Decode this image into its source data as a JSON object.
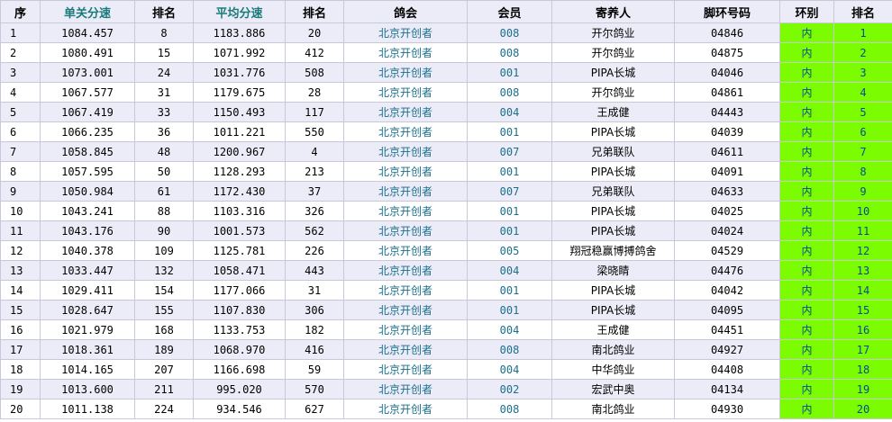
{
  "headers": [
    "序",
    "单关分速",
    "排名",
    "平均分速",
    "排名",
    "鸽会",
    "会员",
    "寄养人",
    "脚环号码",
    "环别",
    "排名"
  ],
  "rows": [
    [
      "1",
      "1084.457",
      "8",
      "1183.886",
      "20",
      "北京开创者",
      "008",
      "开尔鸽业",
      "04846",
      "内",
      "1"
    ],
    [
      "2",
      "1080.491",
      "15",
      "1071.992",
      "412",
      "北京开创者",
      "008",
      "开尔鸽业",
      "04875",
      "内",
      "2"
    ],
    [
      "3",
      "1073.001",
      "24",
      "1031.776",
      "508",
      "北京开创者",
      "001",
      "PIPA长城",
      "04046",
      "内",
      "3"
    ],
    [
      "4",
      "1067.577",
      "31",
      "1179.675",
      "28",
      "北京开创者",
      "008",
      "开尔鸽业",
      "04861",
      "内",
      "4"
    ],
    [
      "5",
      "1067.419",
      "33",
      "1150.493",
      "117",
      "北京开创者",
      "004",
      "王成健",
      "04443",
      "内",
      "5"
    ],
    [
      "6",
      "1066.235",
      "36",
      "1011.221",
      "550",
      "北京开创者",
      "001",
      "PIPA长城",
      "04039",
      "内",
      "6"
    ],
    [
      "7",
      "1058.845",
      "48",
      "1200.967",
      "4",
      "北京开创者",
      "007",
      "兄弟联队",
      "04611",
      "内",
      "7"
    ],
    [
      "8",
      "1057.595",
      "50",
      "1128.293",
      "213",
      "北京开创者",
      "001",
      "PIPA长城",
      "04091",
      "内",
      "8"
    ],
    [
      "9",
      "1050.984",
      "61",
      "1172.430",
      "37",
      "北京开创者",
      "007",
      "兄弟联队",
      "04633",
      "内",
      "9"
    ],
    [
      "10",
      "1043.241",
      "88",
      "1103.316",
      "326",
      "北京开创者",
      "001",
      "PIPA长城",
      "04025",
      "内",
      "10"
    ],
    [
      "11",
      "1043.176",
      "90",
      "1001.573",
      "562",
      "北京开创者",
      "001",
      "PIPA长城",
      "04024",
      "内",
      "11"
    ],
    [
      "12",
      "1040.378",
      "109",
      "1125.781",
      "226",
      "北京开创者",
      "005",
      "翔冠稳赢博搏鸽舍",
      "04529",
      "内",
      "12"
    ],
    [
      "13",
      "1033.447",
      "132",
      "1058.471",
      "443",
      "北京开创者",
      "004",
      "梁晓睛",
      "04476",
      "内",
      "13"
    ],
    [
      "14",
      "1029.411",
      "154",
      "1177.066",
      "31",
      "北京开创者",
      "001",
      "PIPA长城",
      "04042",
      "内",
      "14"
    ],
    [
      "15",
      "1028.647",
      "155",
      "1107.830",
      "306",
      "北京开创者",
      "001",
      "PIPA长城",
      "04095",
      "内",
      "15"
    ],
    [
      "16",
      "1021.979",
      "168",
      "1133.753",
      "182",
      "北京开创者",
      "004",
      "王成健",
      "04451",
      "内",
      "16"
    ],
    [
      "17",
      "1018.361",
      "189",
      "1068.970",
      "416",
      "北京开创者",
      "008",
      "南北鸽业",
      "04927",
      "内",
      "17"
    ],
    [
      "18",
      "1014.165",
      "207",
      "1166.698",
      "59",
      "北京开创者",
      "004",
      "中华鸽业",
      "04408",
      "内",
      "18"
    ],
    [
      "19",
      "1013.600",
      "211",
      "995.020",
      "570",
      "北京开创者",
      "002",
      "宏武中奥",
      "04134",
      "内",
      "19"
    ],
    [
      "20",
      "1011.138",
      "224",
      "934.546",
      "627",
      "北京开创者",
      "008",
      "南北鸽业",
      "04930",
      "内",
      "20"
    ]
  ],
  "colors": {
    "header_bg": "#ececf8",
    "row_alt_bg": "#ececf8",
    "highlight_green": "#7cfc00",
    "link_teal": "#1a6e8a"
  }
}
